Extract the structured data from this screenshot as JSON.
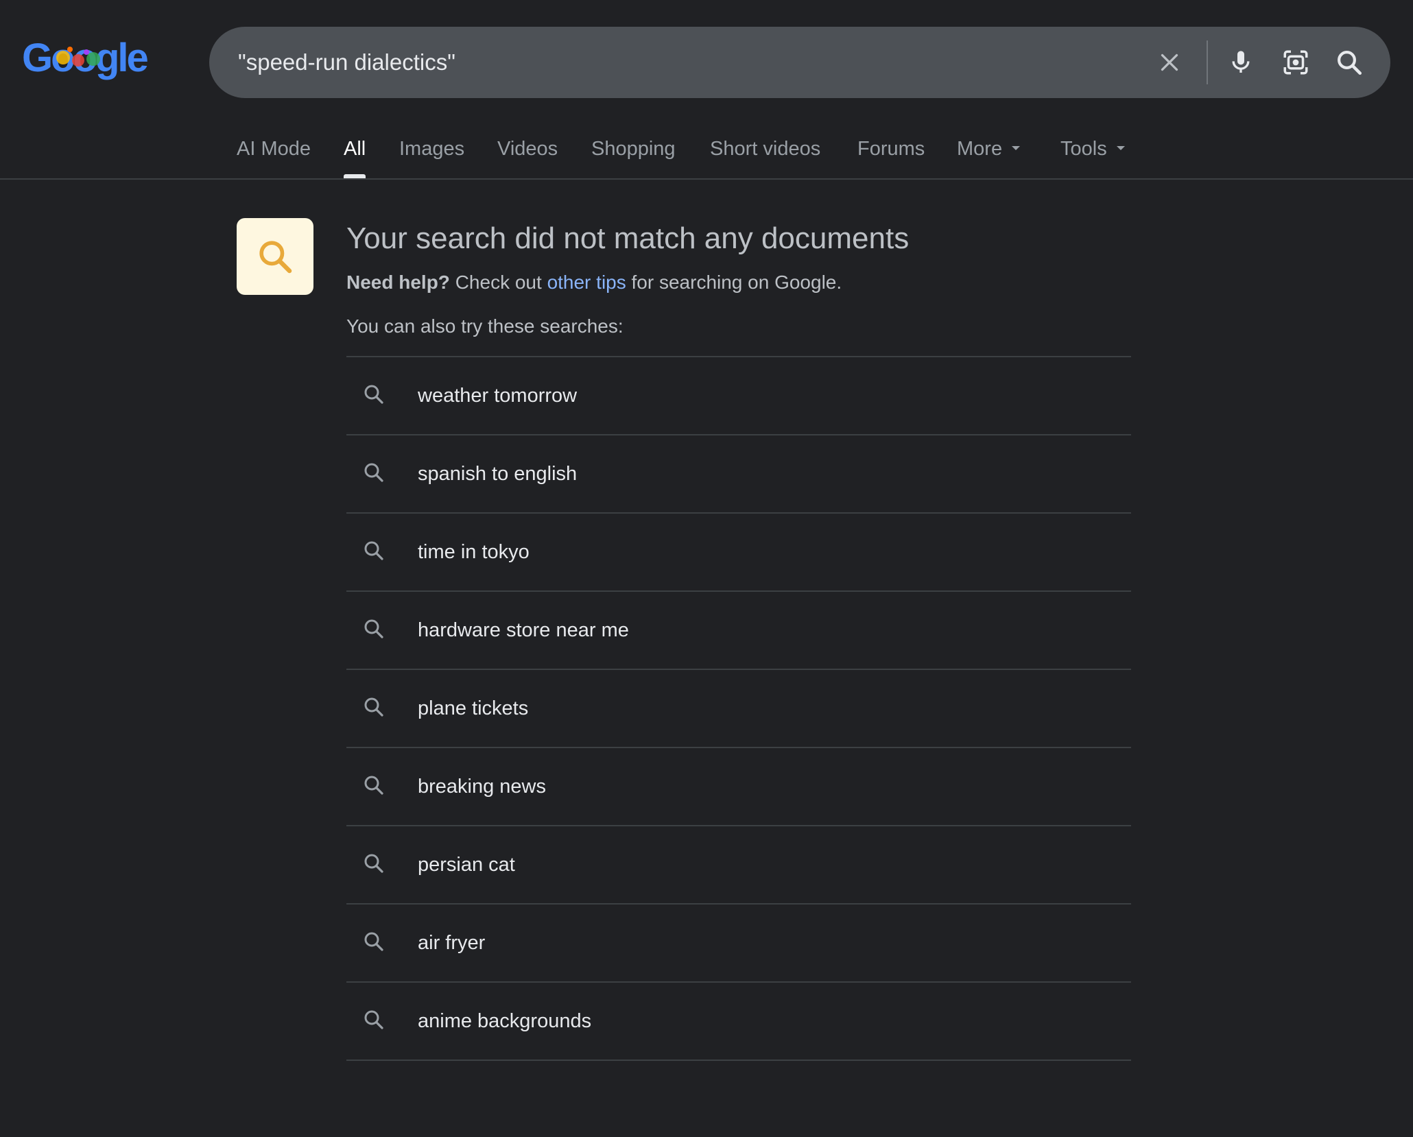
{
  "logo": {
    "text": "Google"
  },
  "search": {
    "query": "\"speed-run dialectics\""
  },
  "icons": {
    "clear": "close-icon",
    "voice": "microphone-icon",
    "lens": "camera-lens-icon",
    "search": "search-icon"
  },
  "tabs": [
    {
      "label": "AI Mode"
    },
    {
      "label": "All",
      "active": true
    },
    {
      "label": "Images"
    },
    {
      "label": "Videos"
    },
    {
      "label": "Shopping"
    },
    {
      "label": "Short videos"
    },
    {
      "label": "Forums"
    },
    {
      "label": "More"
    },
    {
      "label": "Tools"
    }
  ],
  "no_results": {
    "title": "Your search did not match any documents",
    "help_bold": "Need help?",
    "help_pre": "Check out",
    "help_link": "other tips",
    "help_post": "for searching on Google.",
    "try_label": "You can also try these searches:"
  },
  "suggestions": [
    "weather tomorrow",
    "spanish to english",
    "time in tokyo",
    "hardware store near me",
    "plane tickets",
    "breaking news",
    "persian cat",
    "air fryer",
    "anime backgrounds"
  ],
  "colors": {
    "background": "#202124",
    "search_box": "#4d5156",
    "link": "#8ab4f8",
    "nores_icon_bg": "#fef7e0",
    "nores_icon_fg": "#e8a93a"
  }
}
